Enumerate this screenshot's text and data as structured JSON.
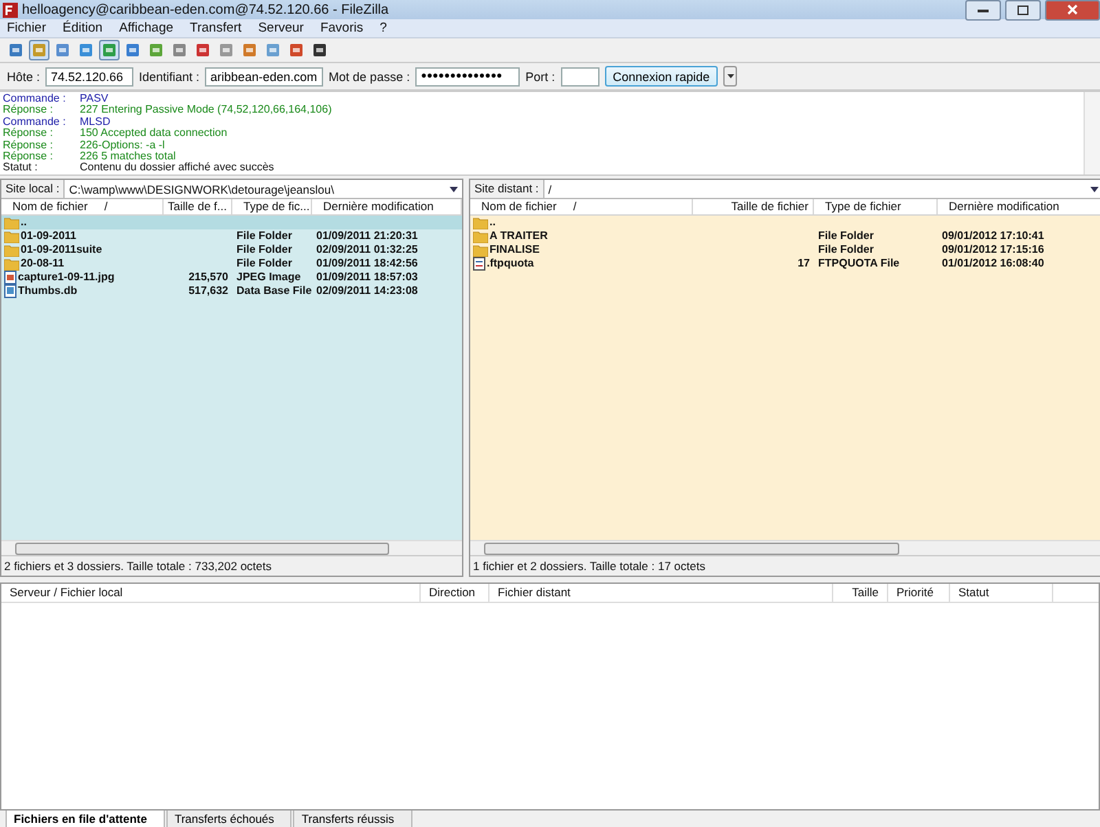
{
  "window": {
    "title": "helloagency@caribbean-eden.com@74.52.120.66 - FileZilla"
  },
  "menu": [
    "Fichier",
    "Édition",
    "Affichage",
    "Transfert",
    "Serveur",
    "Favoris",
    "?"
  ],
  "toolbar": [
    {
      "selected": false
    },
    {
      "selected": true
    },
    {
      "selected": false
    },
    {
      "selected": false
    },
    {
      "selected": true
    },
    {
      "selected": false
    },
    {
      "selected": false
    },
    {
      "selected": false
    },
    {
      "selected": false
    },
    {
      "selected": false
    },
    {
      "selected": false
    },
    {
      "selected": false
    },
    {
      "selected": false
    },
    {
      "selected": false
    }
  ],
  "quickconnect": {
    "host_label": "Hôte :",
    "host": "74.52.120.66",
    "user_label": "Identifiant :",
    "user": "aribbean-eden.com",
    "pass_label": "Mot de passe :",
    "pass": "●●●●●●●●●●●●●●",
    "port_label": "Port :",
    "button": "Connexion rapide"
  },
  "log": [
    {
      "kind": "command",
      "label": "Commande :",
      "text": "PASV"
    },
    {
      "kind": "response",
      "label": "Réponse :",
      "text": "227 Entering Passive Mode (74,52,120,66,164,106)"
    },
    {
      "kind": "command",
      "label": "Commande :",
      "text": "MLSD"
    },
    {
      "kind": "response",
      "label": "Réponse :",
      "text": "150 Accepted data connection"
    },
    {
      "kind": "response",
      "label": "Réponse :",
      "text": "226-Options: -a -l"
    },
    {
      "kind": "response",
      "label": "Réponse :",
      "text": "226 5 matches total"
    },
    {
      "kind": "status",
      "label": "Statut :",
      "text": "Contenu du dossier affiché avec succès"
    }
  ],
  "panes": [
    {
      "site_label": "Site local :",
      "path": "C:\\wamp\\www\\DESIGNWORK\\detourage\\jeanslou\\",
      "columns": [
        {
          "label": "Nom de fichier",
          "sort_mark": "/"
        },
        {
          "label": "Taille de f..."
        },
        {
          "label": "Type de fic..."
        },
        {
          "label": "Dernière modification"
        }
      ],
      "rows": [
        {
          "kind": "folder",
          "selected": true,
          "name": "..",
          "size": "",
          "type": "",
          "modified": ""
        },
        {
          "kind": "folder",
          "selected": false,
          "name": "01-09-2011",
          "size": "",
          "type": "File Folder",
          "modified": "01/09/2011 21:20:31"
        },
        {
          "kind": "folder",
          "selected": false,
          "name": "01-09-2011suite",
          "size": "",
          "type": "File Folder",
          "modified": "02/09/2011 01:32:25"
        },
        {
          "kind": "folder",
          "selected": false,
          "name": "20-08-11",
          "size": "",
          "type": "File Folder",
          "modified": "01/09/2011 18:42:56"
        },
        {
          "kind": "image",
          "selected": false,
          "name": "capture1-09-11.jpg",
          "size": "215,570",
          "type": "JPEG Image",
          "modified": "01/09/2011 18:57:03"
        },
        {
          "kind": "database",
          "selected": false,
          "name": "Thumbs.db",
          "size": "517,632",
          "type": "Data Base File",
          "modified": "02/09/2011 14:23:08"
        }
      ],
      "status": "2 fichiers et 3 dossiers. Taille totale : 733,202 octets"
    },
    {
      "site_label": "Site distant :",
      "path": "/",
      "columns": [
        {
          "label": "Nom de fichier",
          "sort_mark": "/"
        },
        {
          "label": "Taille de fichier"
        },
        {
          "label": "Type de fichier"
        },
        {
          "label": "Dernière modification"
        }
      ],
      "rows": [
        {
          "kind": "folder",
          "selected": false,
          "name": "..",
          "size": "",
          "type": "",
          "modified": ""
        },
        {
          "kind": "folder",
          "selected": false,
          "name": "A TRAITER",
          "size": "",
          "type": "File Folder",
          "modified": "09/01/2012 17:10:41"
        },
        {
          "kind": "folder",
          "selected": false,
          "name": "FINALISE",
          "size": "",
          "type": "File Folder",
          "modified": "09/01/2012 17:15:16"
        },
        {
          "kind": "file",
          "selected": false,
          "name": ".ftpquota",
          "size": "17",
          "type": "FTPQUOTA File",
          "modified": "01/01/2012 16:08:40"
        }
      ],
      "status": "1 fichier et 2 dossiers. Taille totale : 17 octets"
    }
  ],
  "queue": {
    "columns": [
      "Serveur / Fichier local",
      "Direction",
      "Fichier distant",
      "Taille",
      "Priorité",
      "Statut"
    ]
  },
  "tabs": [
    {
      "label": "Fichiers en file d'attente",
      "selected": true
    },
    {
      "label": "Transferts échoués",
      "selected": false
    },
    {
      "label": "Transferts réussis",
      "selected": false
    }
  ]
}
